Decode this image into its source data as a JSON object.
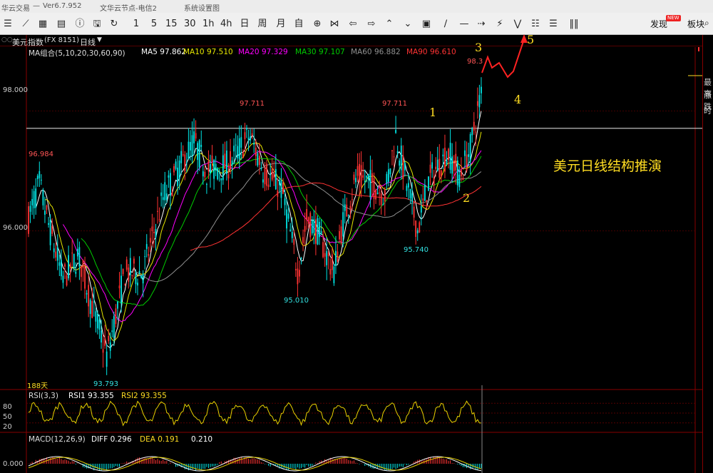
{
  "window": {
    "app_name": "华云交易",
    "separator": "—",
    "version": "Ver6.7.952",
    "server": "文华云节点-电信2",
    "system_menu": "系统设置图"
  },
  "toolbar": {
    "buttons": [
      {
        "name": "menu-icon",
        "label": "☰"
      },
      {
        "name": "chart-line-icon",
        "label": "⟋"
      },
      {
        "name": "grid-icon",
        "label": "▦"
      },
      {
        "name": "calendar-icon",
        "label": "▤"
      },
      {
        "name": "info-icon",
        "label": "ⓘ"
      },
      {
        "name": "save-icon",
        "label": "🖫"
      },
      {
        "name": "refresh-icon",
        "label": "↻"
      },
      {
        "name": "period-1m",
        "label": "1"
      },
      {
        "name": "period-5m",
        "label": "5"
      },
      {
        "name": "period-15m",
        "label": "15"
      },
      {
        "name": "period-30m",
        "label": "30"
      },
      {
        "name": "period-1h",
        "label": "1h"
      },
      {
        "name": "period-4h",
        "label": "4h"
      },
      {
        "name": "period-day",
        "label": "日"
      },
      {
        "name": "period-week",
        "label": "周"
      },
      {
        "name": "period-month",
        "label": "月"
      },
      {
        "name": "period-custom",
        "label": "自"
      },
      {
        "name": "zoom-in-icon",
        "label": "⊕"
      },
      {
        "name": "bowtie-icon",
        "label": "⋈"
      },
      {
        "name": "scroll-left-icon",
        "label": "⇦"
      },
      {
        "name": "scroll-right-icon",
        "label": "⇨"
      },
      {
        "name": "double-up-icon",
        "label": "⌃"
      },
      {
        "name": "double-down-icon",
        "label": "⌄"
      },
      {
        "name": "layout-icon",
        "label": "▣"
      },
      {
        "name": "draw-line-icon",
        "label": "∕"
      },
      {
        "name": "hline-icon",
        "label": "—"
      },
      {
        "name": "arrow-icon",
        "label": "⇢"
      },
      {
        "name": "wave-icon",
        "label": "⚡"
      },
      {
        "name": "fib-icon",
        "label": "⋁"
      },
      {
        "name": "bars-icon",
        "label": "☷"
      },
      {
        "name": "lines-icon",
        "label": "☰"
      },
      {
        "name": "columns-icon",
        "label": "‖‖"
      },
      {
        "name": "more-icon",
        "label": "⋯"
      }
    ],
    "discover_label": "发现",
    "new_badge": "NEW",
    "sector_label": "板块",
    "search_icon": "search-icon"
  },
  "header": {
    "chart_title": "美元指数",
    "symbol_code": "(FX 8151)",
    "period": "日线",
    "side_title": "美"
  },
  "ma_line": {
    "group": "MA组合(5,10,20,30,60,90)",
    "ma5": "MA5 97.862",
    "ma10": "MA10 97.510",
    "ma20": "MA20 97.329",
    "ma30": "MA30 97.107",
    "ma60": "MA60 96.882",
    "ma90": "MA90 96.610"
  },
  "colors": {
    "ma5": "#ffffff",
    "ma10": "#e6e600",
    "ma20": "#ff00ff",
    "ma30": "#00cc00",
    "ma60": "#909090",
    "ma90": "#ff3333",
    "up": "#ff3333",
    "down": "#00e5e5",
    "annotation": "#ffdd22"
  },
  "price_axis": {
    "labels": [
      "98.000",
      "96.000"
    ],
    "values": [
      98.0,
      96.0
    ]
  },
  "price_markers": [
    "97.711",
    "97.711",
    "96.984",
    "95.010",
    "95.740",
    "93.793",
    "98.3"
  ],
  "annotations": {
    "wave_1": "1",
    "wave_2": "2",
    "wave_3": "3",
    "wave_4": "4",
    "wave_5": "5",
    "chart_note": "美元日线结构推演",
    "days_label": "188天"
  },
  "right_panel": {
    "highest_label": "最高",
    "change_label": "涨跌",
    "time_label": "时"
  },
  "rsi": {
    "label": "RSI(3,3)",
    "rsi1": "RSI1 93.355",
    "rsi2": "RSI2 93.355",
    "levels": [
      "80",
      "50",
      "20"
    ]
  },
  "macd": {
    "label": "MACD(12,26,9)",
    "diff": "DIFF 0.296",
    "dea": "DEA 0.191",
    "macd": "0.210",
    "zero": "0.000"
  },
  "chart_data": {
    "type": "candlestick",
    "series_labels": [
      "MA5",
      "MA10",
      "MA20",
      "MA30",
      "MA60",
      "MA90"
    ],
    "ylim": [
      93.4,
      98.9
    ],
    "key_points": [
      {
        "label": "96.984",
        "value": 96.984
      },
      {
        "label": "93.793",
        "value": 93.793
      },
      {
        "label": "97.711",
        "value": 97.711
      },
      {
        "label": "95.010",
        "value": 95.01
      },
      {
        "label": "97.711",
        "value": 97.711
      },
      {
        "label": "95.740",
        "value": 95.74
      },
      {
        "label": "98.3",
        "value": 98.35
      }
    ],
    "resistance": 97.711
  }
}
